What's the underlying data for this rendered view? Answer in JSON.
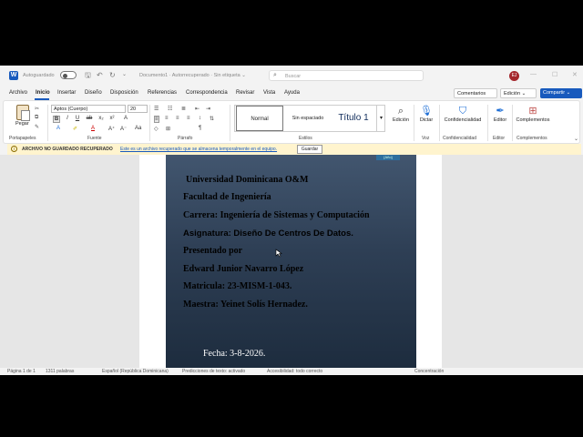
{
  "titlebar": {
    "autosave_label": "Autoguardado",
    "doc_title": "Documento1 · Autorrecuperado · Sin etiqueta ⌄",
    "search_placeholder": "Buscar",
    "avatar_initials": "EJ"
  },
  "menu": {
    "tabs": [
      "Archivo",
      "Inicio",
      "Insertar",
      "Diseño",
      "Disposición",
      "Referencias",
      "Correspondencia",
      "Revisar",
      "Vista",
      "Ayuda"
    ],
    "active_tab": "Inicio",
    "comments_label": "Comentarios",
    "edition_label": "Edición ⌄",
    "share_label": "Compartir ⌄"
  },
  "ribbon": {
    "paste_label": "Pegar",
    "font_name": "Aptos (Cuerpo)",
    "font_size": "20",
    "styles": {
      "normal": "Normal",
      "no_spacing": "Sin espaciado",
      "title1": "Título 1"
    },
    "buttons": {
      "edicion": "Edición",
      "dictar": "Dictar",
      "confidencialidad": "Confidencialidad",
      "editor": "Editor",
      "complementos": "Complementos"
    },
    "group_labels": {
      "clipboard": "Portapapeles",
      "font": "Fuente",
      "paragraph": "Párrafo",
      "styles": "Estilos",
      "voice": "Voz",
      "sensitivity": "Confidencialidad",
      "editor": "Editor",
      "addins": "Complementos"
    }
  },
  "infobar": {
    "title": "ARCHIVO NO GUARDADO RECUPERADO",
    "message": "Este es un archivo recuperado que se almacena temporalmente en el equipo.",
    "button": "Guardar"
  },
  "document": {
    "tag": "[Año]",
    "lines": {
      "university": "Universidad Dominicana O&M",
      "faculty": "Facultad de Ingeniería",
      "career": "Carrera: Ingeniería de Sistemas y Computación",
      "subject": "Asignatura: Diseño De Centros De Datos.",
      "presented": "Presentado por",
      "student": "Edward Junior Navarro López",
      "enrollment": "Matricula: 23-MISM-1-043.",
      "teacher": "Maestra: Yeinet Solís Hernadez."
    },
    "date": "Fecha: 3-8-2026."
  },
  "statusbar": {
    "page": "Página 1 de 1",
    "words": "1311 palabras",
    "language": "Español (República Dominicana)",
    "predictions": "Predicciones de texto: activado",
    "accessibility": "Accesibilidad: todo correcto",
    "focus": "Concentración"
  },
  "colors": {
    "accent": "#185abd",
    "cover_top": "#42566f",
    "cover_bottom": "#1d2c3e",
    "infobar_bg": "#fff4ce"
  }
}
